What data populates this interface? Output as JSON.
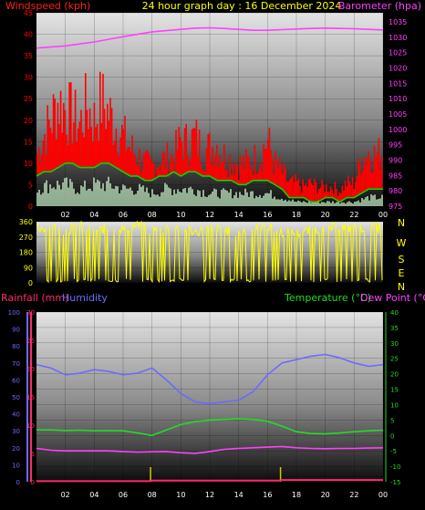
{
  "page": {
    "title": "24 hour graph day : 16 December 2024"
  },
  "colors": {
    "background": "#000000",
    "wind": "#ff0000",
    "wind_avg": "#00dd00",
    "wind_low": "#c8f0c8",
    "barometer": "#ff40ff",
    "direction": "#ffff00",
    "rainfall": "#ff2a6a",
    "humidity": "#6b6bff",
    "temperature": "#22dd22",
    "dew_point": "#ff40ff",
    "rain_bar": "#d4c800",
    "hum_axis": "#6b6bff"
  },
  "chart_data": [
    {
      "id": "wind-baro",
      "type": "line",
      "title": "24 hour graph day : 16 December 2024",
      "y_left_label": "Windspeed (kph)",
      "y_right_label": "Barometer (hpa)",
      "x_ticks": [
        "02",
        "04",
        "06",
        "08",
        "10",
        "12",
        "14",
        "16",
        "18",
        "20",
        "22",
        "00"
      ],
      "y_left_ticks": [
        0,
        5,
        10,
        15,
        20,
        25,
        30,
        35,
        40,
        45
      ],
      "y_left_range": [
        0,
        45
      ],
      "y_right_ticks": [
        975,
        980,
        985,
        990,
        995,
        1000,
        1005,
        1010,
        1015,
        1020,
        1025,
        1030,
        1035
      ],
      "y_right_range": [
        975,
        1038
      ],
      "x_range_hours": [
        0,
        24
      ],
      "grid": true,
      "series": [
        {
          "name": "Barometer (hpa)",
          "x": [
            0,
            2,
            4,
            6,
            8,
            10,
            11,
            12,
            13,
            14,
            15,
            16,
            17,
            18,
            19,
            20,
            21,
            22,
            23,
            24
          ],
          "values": [
            1026.5,
            1027.2,
            1028.5,
            1030.2,
            1031.8,
            1032.6,
            1033,
            1033.1,
            1032.9,
            1032.6,
            1032.3,
            1032.3,
            1032.5,
            1032.7,
            1032.9,
            1033,
            1032.9,
            1032.8,
            1032.6,
            1032.4
          ]
        },
        {
          "name": "Wind gust",
          "x": [
            0,
            0.5,
            1,
            1.5,
            2,
            2.5,
            3,
            3.5,
            4,
            4.5,
            5,
            5.5,
            6,
            6.5,
            7,
            7.5,
            8,
            8.5,
            9,
            9.5,
            10,
            10.5,
            11,
            11.5,
            12,
            12.5,
            13,
            13.5,
            14,
            14.5,
            15,
            15.5,
            16,
            16.5,
            17,
            17.5,
            18,
            18.5,
            19,
            19.5,
            20,
            20.5,
            21,
            21.5,
            22,
            22.5,
            23,
            23.5,
            24
          ],
          "values": [
            13,
            18,
            22,
            27,
            25,
            23,
            21,
            26,
            22,
            27,
            24,
            21,
            18,
            15,
            13,
            11,
            10,
            12,
            12,
            13,
            17,
            16,
            18,
            14,
            15,
            16,
            13,
            12,
            11,
            11,
            12,
            13,
            17,
            11,
            9,
            6,
            6,
            5,
            6,
            5,
            5,
            5,
            4,
            6,
            6,
            12,
            14,
            13,
            14
          ]
        },
        {
          "name": "Wind average",
          "x": [
            0,
            0.5,
            1,
            1.5,
            2,
            2.5,
            3,
            3.5,
            4,
            4.5,
            5,
            5.5,
            6,
            6.5,
            7,
            7.5,
            8,
            8.5,
            9,
            9.5,
            10,
            10.5,
            11,
            11.5,
            12,
            12.5,
            13,
            13.5,
            14,
            14.5,
            15,
            15.5,
            16,
            16.5,
            17,
            17.5,
            18,
            18.5,
            19,
            19.5,
            20,
            20.5,
            21,
            21.5,
            22,
            22.5,
            23,
            23.5,
            24
          ],
          "values": [
            7,
            8,
            8,
            9,
            10,
            10,
            9,
            9,
            9,
            10,
            10,
            9,
            8,
            7,
            7,
            6,
            6,
            7,
            7,
            8,
            7,
            8,
            8,
            7,
            7,
            6,
            6,
            6,
            5,
            5,
            6,
            6,
            6,
            5,
            4,
            2,
            2,
            2,
            1,
            1,
            2,
            2,
            1,
            2,
            2,
            3,
            4,
            4,
            4
          ]
        },
        {
          "name": "Wind low",
          "x": [
            0,
            1,
            2,
            3,
            4,
            5,
            6,
            7,
            8,
            9,
            10,
            11,
            12,
            13,
            14,
            15,
            16,
            17,
            18,
            19,
            20,
            21,
            22,
            23,
            24
          ],
          "values": [
            4,
            5,
            5,
            4,
            5,
            5,
            4,
            4,
            3,
            4,
            4,
            4,
            3,
            3,
            3,
            3,
            3,
            2,
            1,
            1,
            1,
            1,
            1,
            2,
            2
          ]
        }
      ]
    },
    {
      "id": "direction",
      "type": "line",
      "y_ticks": [
        0,
        90,
        180,
        270,
        360
      ],
      "y_range": [
        0,
        360
      ],
      "compass": [
        "N",
        "W",
        "S",
        "E",
        "N"
      ],
      "x_range_hours": [
        0,
        24
      ],
      "series": [
        {
          "name": "Wind direction",
          "x": [
            0,
            1,
            2,
            3,
            4,
            5,
            6,
            7,
            8,
            9,
            10,
            11,
            12,
            13,
            14,
            15,
            16,
            17,
            18,
            19,
            20,
            21,
            22,
            23,
            24
          ],
          "values": [
            320,
            330,
            310,
            340,
            300,
            330,
            320,
            340,
            310,
            320,
            330,
            300,
            320,
            310,
            300,
            320,
            330,
            300,
            290,
            310,
            320,
            330,
            320,
            330,
            320
          ]
        }
      ]
    },
    {
      "id": "temp-hum-rain",
      "type": "line",
      "labels": {
        "rainfall": "Rainfall (mm)",
        "humidity": "Humidity",
        "temperature": "Temperature (°C)",
        "dew_point": "Dew Point (°C)"
      },
      "x_ticks": [
        "02",
        "04",
        "06",
        "08",
        "10",
        "12",
        "14",
        "16",
        "18",
        "20",
        "22",
        "00"
      ],
      "humidity_ticks": [
        0,
        10,
        20,
        30,
        40,
        50,
        60,
        70,
        80,
        90,
        100
      ],
      "humidity_range": [
        0,
        100
      ],
      "rain_ticks": [
        0,
        5,
        10,
        15,
        20,
        25,
        30
      ],
      "rain_range": [
        0,
        30
      ],
      "temp_ticks": [
        -15,
        -10,
        -5,
        0,
        5,
        10,
        15,
        20,
        25,
        30,
        35,
        40
      ],
      "temp_range": [
        -15,
        40
      ],
      "x_range_hours": [
        0,
        24
      ],
      "grid": true,
      "series": [
        {
          "name": "Humidity",
          "axis": "humidity",
          "x": [
            0,
            1,
            2,
            3,
            4,
            5,
            6,
            7,
            8,
            9,
            10,
            11,
            12,
            13,
            14,
            15,
            16,
            17,
            18,
            19,
            20,
            21,
            22,
            23,
            24
          ],
          "values": [
            69,
            67,
            63,
            64,
            66,
            65,
            63,
            64,
            67,
            60,
            52,
            47,
            46,
            47,
            48,
            53,
            63,
            70,
            72,
            74,
            75,
            73,
            70,
            68,
            69
          ]
        },
        {
          "name": "Temperature (°C)",
          "axis": "temp",
          "x": [
            0,
            1,
            2,
            3,
            4,
            5,
            6,
            7,
            8,
            9,
            10,
            11,
            12,
            13,
            14,
            15,
            16,
            17,
            18,
            19,
            20,
            21,
            22,
            23,
            24
          ],
          "values": [
            1.8,
            1.8,
            1.6,
            1.7,
            1.5,
            1.6,
            1.5,
            0.8,
            0,
            1.8,
            3.5,
            4.5,
            5,
            5.2,
            5.4,
            5.2,
            4.6,
            3,
            1.2,
            0.6,
            0.5,
            0.8,
            1.2,
            1.5,
            1.7
          ]
        },
        {
          "name": "Dew Point (°C)",
          "axis": "temp",
          "x": [
            0,
            1,
            2,
            3,
            4,
            5,
            6,
            7,
            8,
            9,
            10,
            11,
            12,
            13,
            14,
            15,
            16,
            17,
            18,
            19,
            20,
            21,
            22,
            23,
            24
          ],
          "values": [
            -4.2,
            -4.8,
            -5,
            -5,
            -5,
            -5,
            -5.2,
            -5.4,
            -5.3,
            -5.2,
            -5.6,
            -5.8,
            -5.2,
            -4.5,
            -4.2,
            -4,
            -3.8,
            -3.6,
            -4,
            -4.2,
            -4.3,
            -4.2,
            -4.2,
            -4.1,
            -4
          ]
        },
        {
          "name": "Rainfall (mm)",
          "axis": "rain",
          "x": [
            0,
            7.9,
            8,
            16.9,
            17,
            24
          ],
          "values": [
            0.1,
            0.1,
            0.2,
            0.2,
            0.3,
            0.3
          ]
        }
      ]
    }
  ]
}
